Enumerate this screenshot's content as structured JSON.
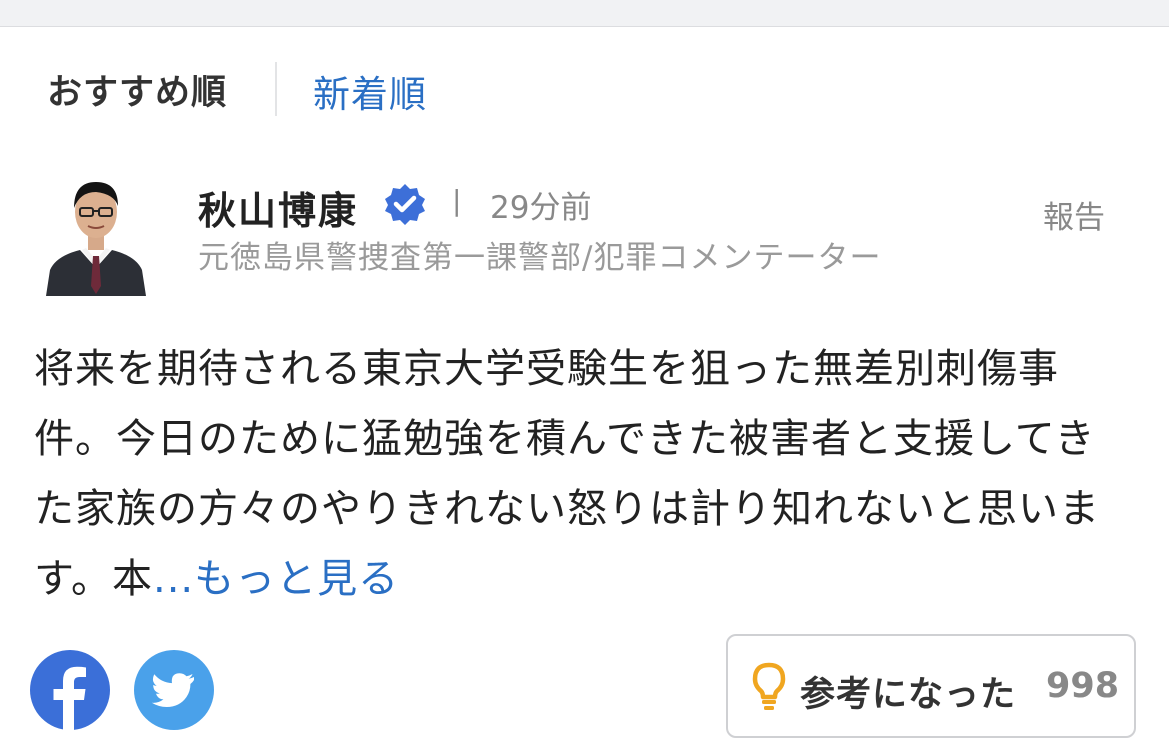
{
  "sort": {
    "recommended": "おすすめ順",
    "newest": "新着順"
  },
  "comment": {
    "author": {
      "name": "秋山博康",
      "title": "元徳島県警捜査第一課警部/犯罪コメンテーター",
      "verified_icon": "verified-check-icon",
      "avatar_icon": "avatar"
    },
    "separator": "|",
    "time_ago": "29分前",
    "report_label": "報告",
    "body_text": "将来を期待される東京大学受験生を狙った無差別刺傷事件。今日のために猛勉強を積んできた被害者と支援してきた家族の方々のやりきれない怒りは計り知れないと思います。本",
    "more_link": "...もっと見る",
    "share": {
      "facebook_icon": "facebook-icon",
      "twitter_icon": "twitter-icon"
    },
    "helpful": {
      "icon": "lightbulb-icon",
      "label": "参考になった",
      "count": "998"
    }
  },
  "colors": {
    "link_blue": "#2a6fc4",
    "facebook_blue": "#3b6fd8",
    "twitter_blue": "#4aa1ea",
    "verified_blue": "#3d6fd8",
    "bulb_orange": "#f0a620"
  }
}
